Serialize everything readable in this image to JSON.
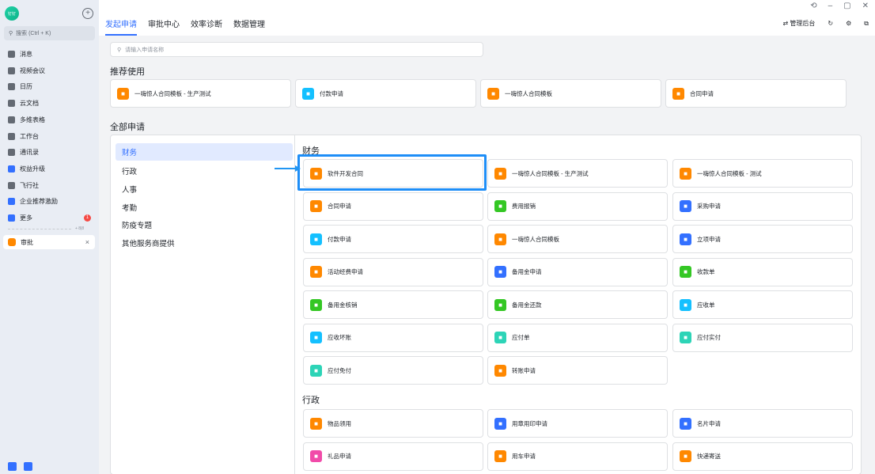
{
  "sidebar": {
    "logo_text": "钉钉",
    "search_placeholder": "搜索 (Ctrl + K)",
    "items": [
      {
        "label": "消息",
        "icon": "message-icon"
      },
      {
        "label": "视频会议",
        "icon": "video-icon"
      },
      {
        "label": "日历",
        "icon": "calendar-icon"
      },
      {
        "label": "云文档",
        "icon": "doc-icon"
      },
      {
        "label": "多维表格",
        "icon": "table-icon"
      },
      {
        "label": "工作台",
        "icon": "grid-icon"
      },
      {
        "label": "通讯录",
        "icon": "contacts-icon"
      },
      {
        "label": "权益升级",
        "icon": "diamond-icon"
      },
      {
        "label": "飞行社",
        "icon": "book-icon"
      },
      {
        "label": "企业推荐激励",
        "icon": "people-icon"
      },
      {
        "label": "更多",
        "icon": "more-icon",
        "badge": "1"
      }
    ],
    "pinned_label": "+ 8|8",
    "open_tab": "审批"
  },
  "header": {
    "tabs": [
      "发起申请",
      "审批中心",
      "效率诊断",
      "数据管理"
    ],
    "active_tab": 0,
    "admin_label": "管理后台"
  },
  "search": {
    "placeholder": "请输入申请名称"
  },
  "recommended": {
    "title": "推荐使用",
    "items": [
      {
        "label": "一嗨惊人合同模板 - 生产测试",
        "color": "#ff8800",
        "icon": "briefcase-icon"
      },
      {
        "label": "付款申请",
        "color": "#14c0ff",
        "icon": "yen-icon"
      },
      {
        "label": "一嗨惊人合同模板",
        "color": "#ff8800",
        "icon": "briefcase-icon"
      },
      {
        "label": "合同申请",
        "color": "#ff8800",
        "icon": "briefcase-icon"
      }
    ]
  },
  "all": {
    "title": "全部申请",
    "categories": [
      "财务",
      "行政",
      "人事",
      "考勤",
      "防疫专题",
      "其他服务商提供"
    ],
    "active_category": 0,
    "groups": [
      {
        "name": "财务",
        "items": [
          {
            "label": "软件开发合同",
            "color": "#ff8800",
            "icon": "briefcase-icon"
          },
          {
            "label": "一嗨惊人合同模板 - 生产测试",
            "color": "#ff8800",
            "icon": "briefcase-icon"
          },
          {
            "label": "一嗨惊人合同模板 - 测试",
            "color": "#ff8800",
            "icon": "briefcase-icon"
          },
          {
            "label": "合同申请",
            "color": "#ff8800",
            "icon": "briefcase-icon"
          },
          {
            "label": "费用报销",
            "color": "#34c724",
            "icon": "cash-icon"
          },
          {
            "label": "采购申请",
            "color": "#3370ff",
            "icon": "cart-icon"
          },
          {
            "label": "付款申请",
            "color": "#14c0ff",
            "icon": "yen-icon"
          },
          {
            "label": "一嗨惊人合同模板",
            "color": "#ff8800",
            "icon": "briefcase-icon"
          },
          {
            "label": "立项申请",
            "color": "#3370ff",
            "icon": "form-icon"
          },
          {
            "label": "活动经费申请",
            "color": "#ff8800",
            "icon": "ticket-icon"
          },
          {
            "label": "备用金申请",
            "color": "#3370ff",
            "icon": "wallet-icon"
          },
          {
            "label": "收款单",
            "color": "#34c724",
            "icon": "cash-icon"
          },
          {
            "label": "备用金核销",
            "color": "#34c724",
            "icon": "cash-icon"
          },
          {
            "label": "备用金还款",
            "color": "#34c724",
            "icon": "cash-icon"
          },
          {
            "label": "应收单",
            "color": "#14c0ff",
            "icon": "yen-icon"
          },
          {
            "label": "应收坏账",
            "color": "#14c0ff",
            "icon": "yen-icon"
          },
          {
            "label": "应付单",
            "color": "#2dd4b7",
            "icon": "receipt-icon"
          },
          {
            "label": "应付实付",
            "color": "#2dd4b7",
            "icon": "receipt-icon"
          },
          {
            "label": "应付免付",
            "color": "#2dd4b7",
            "icon": "receipt-icon"
          },
          {
            "label": "转账申请",
            "color": "#ff8800",
            "icon": "transfer-icon"
          }
        ]
      },
      {
        "name": "行政",
        "items": [
          {
            "label": "物品领用",
            "color": "#ff8800",
            "icon": "box-icon"
          },
          {
            "label": "用章用印申请",
            "color": "#3370ff",
            "icon": "stamp-icon"
          },
          {
            "label": "名片申请",
            "color": "#3370ff",
            "icon": "card-icon"
          },
          {
            "label": "礼品申请",
            "color": "#f14ba9",
            "icon": "gift-icon"
          },
          {
            "label": "用车申请",
            "color": "#ff8800",
            "icon": "car-icon"
          },
          {
            "label": "快递寄送",
            "color": "#ff8800",
            "icon": "package-icon"
          }
        ]
      }
    ]
  }
}
